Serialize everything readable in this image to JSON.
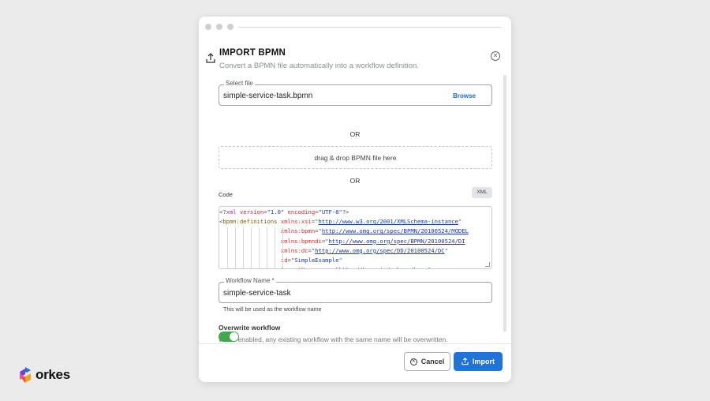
{
  "dialog": {
    "title": "IMPORT BPMN",
    "subtitle": "Convert a BPMN file automatically into a workflow definition."
  },
  "select_file": {
    "label": "Select file",
    "value": "simple-service-task.bpmn",
    "browse_label": "Browse"
  },
  "or_label": "OR",
  "dropzone": {
    "text": "drag & drop BPMN file here"
  },
  "code": {
    "label": "Code",
    "format_badge": "XML",
    "lines": [
      [
        {
          "t": "<?",
          "c": "pun"
        },
        {
          "t": "xml",
          "c": "kw"
        },
        {
          "t": " ",
          "c": "pun"
        },
        {
          "t": "version",
          "c": "attr"
        },
        {
          "t": "=",
          "c": "pun"
        },
        {
          "t": "\"1.0\"",
          "c": "str"
        },
        {
          "t": " ",
          "c": "pun"
        },
        {
          "t": "encoding",
          "c": "attr"
        },
        {
          "t": "=",
          "c": "pun"
        },
        {
          "t": "\"UTF-8\"",
          "c": "str"
        },
        {
          "t": "?>",
          "c": "pun"
        }
      ],
      [
        {
          "t": "<",
          "c": "pun"
        },
        {
          "t": "bpmn:definitions",
          "c": "tag"
        },
        {
          "t": " ",
          "c": "pun"
        },
        {
          "t": "xmlns:xsi",
          "c": "attr"
        },
        {
          "t": "=\"",
          "c": "pun"
        },
        {
          "t": "http://www.w3.org/2001/XMLSchema-instance",
          "c": "url"
        },
        {
          "t": "\"",
          "c": "pun"
        }
      ],
      [
        {
          "t": "                  ",
          "c": "pun"
        },
        {
          "t": "xmlns:bpmn",
          "c": "attr"
        },
        {
          "t": "=\"",
          "c": "pun"
        },
        {
          "t": "http://www.omg.org/spec/BPMN/20100524/MODEL",
          "c": "url"
        }
      ],
      [
        {
          "t": "                  ",
          "c": "pun"
        },
        {
          "t": "xmlns:bpmndi",
          "c": "attr"
        },
        {
          "t": "=\"",
          "c": "pun"
        },
        {
          "t": "http://www.omg.org/spec/BPMN/20100524/DI",
          "c": "url"
        }
      ],
      [
        {
          "t": "                  ",
          "c": "pun"
        },
        {
          "t": "xmlns:dc",
          "c": "attr"
        },
        {
          "t": "=\"",
          "c": "pun"
        },
        {
          "t": "http://www.omg.org/spec/DD/20100524/DC",
          "c": "url"
        },
        {
          "t": "\"",
          "c": "pun"
        }
      ],
      [
        {
          "t": "                  ",
          "c": "pun"
        },
        {
          "t": "id",
          "c": "attr"
        },
        {
          "t": "=\"",
          "c": "pun"
        },
        {
          "t": "SimpleExample",
          "c": "str"
        },
        {
          "t": "\"",
          "c": "pun"
        }
      ],
      [
        {
          "t": "                  ",
          "c": "pun"
        },
        {
          "t": "targetNamespace",
          "c": "attr"
        },
        {
          "t": "=\"",
          "c": "pun"
        },
        {
          "t": "http://bpmn.io/schema/bpmn",
          "c": "str"
        },
        {
          "t": "\">",
          "c": "pun"
        }
      ]
    ]
  },
  "workflow_name": {
    "label": "Workflow Name *",
    "value": "simple-service-task",
    "helper": "This will be used as the workflow name"
  },
  "overwrite": {
    "title": "Overwrite workflow",
    "description": "When enabled, any existing workflow with the same name will be overwritten.",
    "enabled": true
  },
  "buttons": {
    "cancel": "Cancel",
    "import": "Import"
  },
  "brand": {
    "logo_text": "orkes",
    "accent": "#1f73d9",
    "toggle_on": "#40a84a"
  }
}
